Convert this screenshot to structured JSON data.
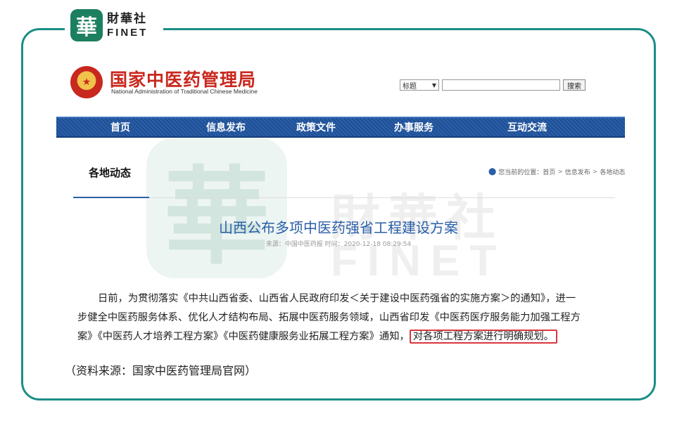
{
  "brand": {
    "mark": "華",
    "name_cn": "財華社",
    "name_en": "FINET"
  },
  "site": {
    "name_cn": "国家中医药管理局",
    "name_en": "National Administration of Traditional Chinese Medicine"
  },
  "search": {
    "select_value": "标题",
    "button_label": "搜索"
  },
  "nav": {
    "items": [
      "首页",
      "信息发布",
      "政策文件",
      "办事服务",
      "互动交流"
    ]
  },
  "section": {
    "title": "各地动态",
    "breadcrumb": {
      "prefix": "您当前的位置：",
      "items": [
        "首页",
        "信息发布",
        "各地动态"
      ],
      "separator": ">"
    }
  },
  "article": {
    "title": "山西公布多项中医药强省工程建设方案",
    "meta": "来源：中国中医药报 时间：2020-12-18 08:29:54",
    "body_line1": "日前，为贯彻落实《中共山西省委、山西省人民政府印发＜关于建设中医药强省的实施方案＞的通知》，进一",
    "body_line2": "步健全中医药服务体系、优化人才结构布局、拓展中医药服务领域，山西省印发《中医药医疗服务能力加强工程方",
    "body_line3": "案》《中医药人才培养工程方案》《中医药健康服务业拓展工程方案》通知，",
    "body_highlight": "对各项工程方案进行明确规划。"
  },
  "source_note": "（资料来源：国家中医药管理局官网）",
  "colors": {
    "frame": "#1a8e86",
    "nav": "#2a5fa8",
    "site_red": "#c8281e",
    "highlight_border": "#d9363e",
    "title_blue": "#2a5fa8"
  }
}
